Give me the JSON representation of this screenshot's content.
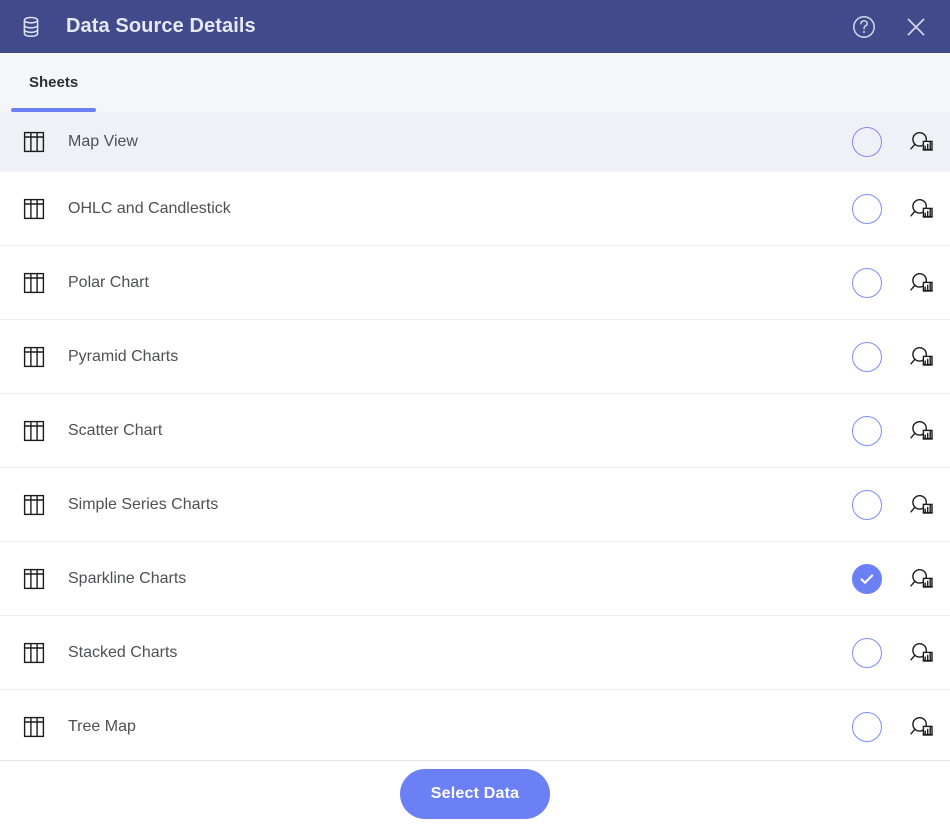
{
  "window": {
    "title": "Data Source Details",
    "icon": "database-icon",
    "header_bg": "#414b8c",
    "header_text_color": "#e6e9f5",
    "help_icon": "help-circle-icon",
    "close_icon": "close-icon"
  },
  "tabs": [
    {
      "label": "Sheets",
      "active": true,
      "indicator_color": "#6c80f5"
    }
  ],
  "list": {
    "row_icon": "table-grid-icon",
    "select_control_icon": "radio-circle-icon",
    "selected_control_icon": "check-circle-icon",
    "preview_icon": "magnifier-chart-icon",
    "accent_color": "#6c80f5",
    "highlight_bg": "#f0f1f7",
    "items": [
      {
        "label": "Map View",
        "selected": false,
        "highlighted": true
      },
      {
        "label": "OHLC and Candlestick",
        "selected": false,
        "highlighted": false
      },
      {
        "label": "Polar Chart",
        "selected": false,
        "highlighted": false
      },
      {
        "label": "Pyramid Charts",
        "selected": false,
        "highlighted": false
      },
      {
        "label": "Scatter Chart",
        "selected": false,
        "highlighted": false
      },
      {
        "label": "Simple Series Charts",
        "selected": false,
        "highlighted": false
      },
      {
        "label": "Sparkline Charts",
        "selected": true,
        "highlighted": false
      },
      {
        "label": "Stacked Charts",
        "selected": false,
        "highlighted": false
      },
      {
        "label": "Tree Map",
        "selected": false,
        "highlighted": false
      }
    ]
  },
  "footer": {
    "primary_button_label": "Select Data",
    "primary_button_color": "#6c80f5"
  }
}
